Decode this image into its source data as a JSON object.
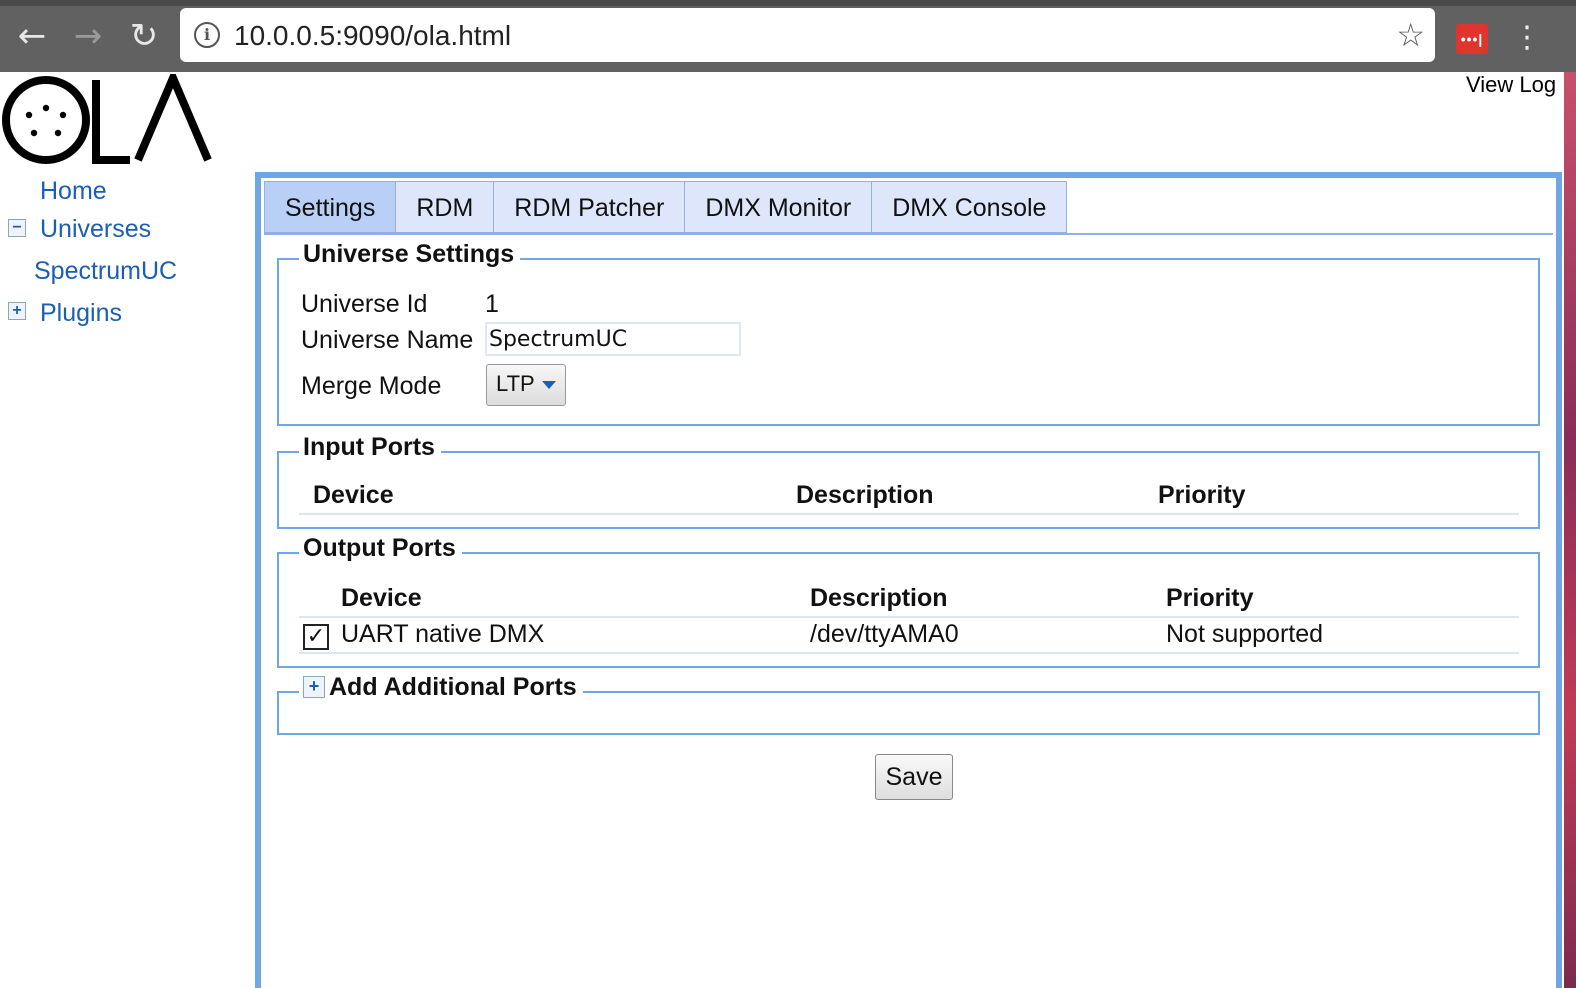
{
  "browser": {
    "url": "10.0.0.5:9090/ola.html",
    "back_icon": "back-arrow-icon",
    "forward_icon": "forward-arrow-icon",
    "reload_icon": "reload-icon",
    "extension_label": "•••|"
  },
  "header": {
    "logo_text": "OLA",
    "view_log": "View Log"
  },
  "sidebar": {
    "home": "Home",
    "universes": "Universes",
    "universe_item": "SpectrumUC",
    "plugins": "Plugins"
  },
  "tabs": [
    "Settings",
    "RDM",
    "RDM Patcher",
    "DMX Monitor",
    "DMX Console"
  ],
  "universe_settings": {
    "legend": "Universe Settings",
    "id_label": "Universe Id",
    "id_value": "1",
    "name_label": "Universe Name",
    "name_value": "SpectrumUC",
    "merge_label": "Merge Mode",
    "merge_value": "LTP"
  },
  "input_ports": {
    "legend": "Input Ports",
    "columns": [
      "Device",
      "Description",
      "Priority"
    ]
  },
  "output_ports": {
    "legend": "Output Ports",
    "columns": [
      "Device",
      "Description",
      "Priority"
    ],
    "rows": [
      {
        "checked": true,
        "device": "UART native DMX",
        "description": "/dev/ttyAMA0",
        "priority": "Not supported"
      }
    ]
  },
  "additional_ports": {
    "legend": "Add Additional Ports"
  },
  "save_label": "Save"
}
